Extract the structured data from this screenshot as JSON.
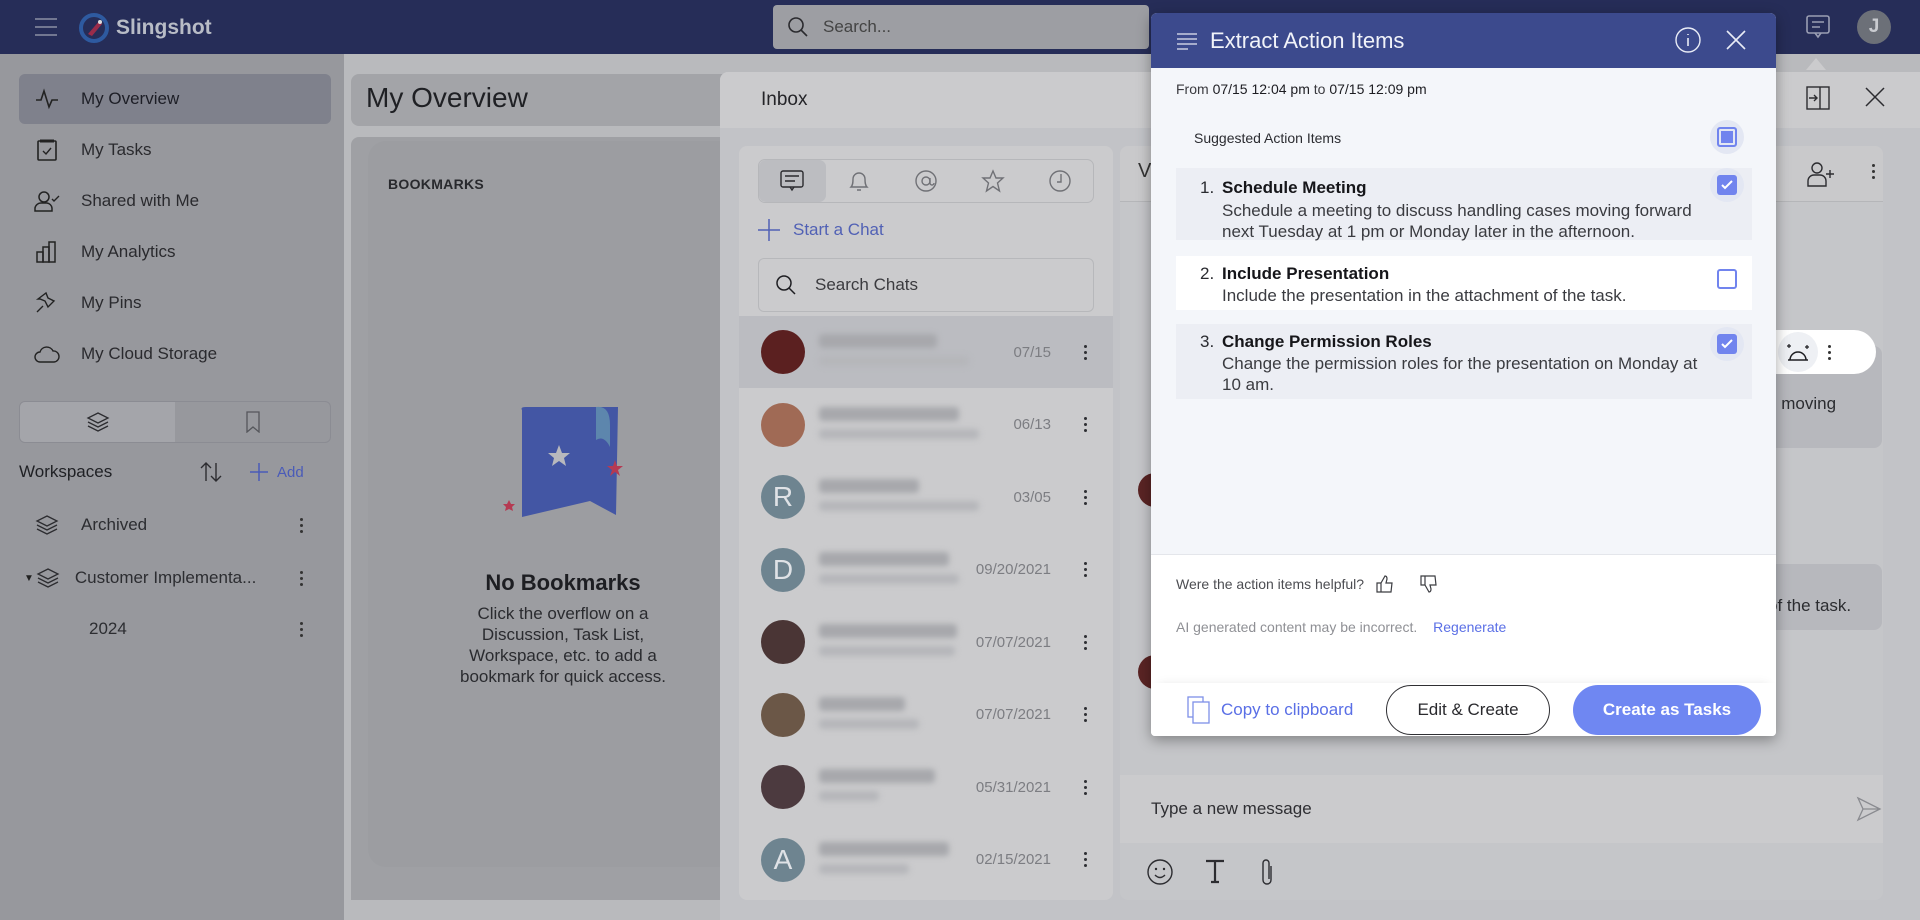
{
  "app": {
    "name": "Slingshot",
    "search_placeholder": "Search...",
    "user_initial": "J"
  },
  "sidebar": {
    "items": [
      {
        "label": "My Overview",
        "icon": "activity-icon",
        "active": true
      },
      {
        "label": "My Tasks",
        "icon": "task-icon",
        "active": false
      },
      {
        "label": "Shared with Me",
        "icon": "shared-user-icon",
        "active": false
      },
      {
        "label": "My Analytics",
        "icon": "analytics-icon",
        "active": false
      },
      {
        "label": "My Pins",
        "icon": "pin-icon",
        "active": false
      },
      {
        "label": "My Cloud Storage",
        "icon": "cloud-icon",
        "active": false
      }
    ],
    "workspaces": {
      "title": "Workspaces",
      "add_label": "Add",
      "items": [
        {
          "label": "Archived"
        },
        {
          "label": "Customer Implementa..."
        },
        {
          "label": "2024"
        }
      ]
    }
  },
  "overview": {
    "title": "My Overview",
    "bookmarks_label": "BOOKMARKS",
    "empty_title": "No Bookmarks",
    "empty_text": "Click the overflow on a Discussion, Task List, Workspace, etc. to add a bookmark for quick access."
  },
  "inbox": {
    "title": "Inbox",
    "start_chat_label": "Start a Chat",
    "search_placeholder": "Search Chats",
    "chats": [
      {
        "date": "07/15",
        "avatar_letter": "",
        "avatar_color": "#5b2020",
        "selected": true
      },
      {
        "date": "06/13",
        "avatar_letter": "",
        "avatar_color": "#a06a55",
        "selected": false
      },
      {
        "date": "03/05",
        "avatar_letter": "R",
        "avatar_color": "#6e8490",
        "selected": false
      },
      {
        "date": "09/20/2021",
        "avatar_letter": "D",
        "avatar_color": "#6e8490",
        "selected": false
      },
      {
        "date": "07/07/2021",
        "avatar_letter": "",
        "avatar_color": "#4a3535",
        "selected": false
      },
      {
        "date": "07/07/2021",
        "avatar_letter": "",
        "avatar_color": "#6b5747",
        "selected": false
      },
      {
        "date": "05/31/2021",
        "avatar_letter": "",
        "avatar_color": "#4c3a3f",
        "selected": false
      },
      {
        "date": "02/15/2021",
        "avatar_letter": "A",
        "avatar_color": "#6e8490",
        "selected": false
      }
    ]
  },
  "conversation": {
    "header_letter": "V",
    "bubble_1_tail": "s moving",
    "bubble_2_tail": "of the task.",
    "message_placeholder": "Type a new message"
  },
  "modal": {
    "title": "Extract Action Items",
    "range_from_label": "From",
    "range_from": "07/15 12:04 pm",
    "range_to_label": "to",
    "range_to": "07/15 12:09 pm",
    "suggested_label": "Suggested Action Items",
    "items": [
      {
        "number": "1.",
        "title": "Schedule Meeting",
        "description": "Schedule a meeting to discuss handling cases moving forward next Tuesday at 1 pm or Monday later in the afternoon.",
        "checked": true
      },
      {
        "number": "2.",
        "title": "Include Presentation",
        "description": "Include the presentation in the attachment of the task.",
        "checked": false
      },
      {
        "number": "3.",
        "title": "Change Permission Roles",
        "description": "Change the permission roles for the presentation on Monday at 10 am.",
        "checked": true
      }
    ],
    "helpful_question": "Were the action items helpful?",
    "disclaimer": "AI generated content may be incorrect.",
    "regenerate_label": "Regenerate",
    "copy_label": "Copy to clipboard",
    "edit_label": "Edit & Create",
    "create_label": "Create as Tasks",
    "accent_color": "#6f87f2",
    "header_color": "#3c4a8d"
  }
}
